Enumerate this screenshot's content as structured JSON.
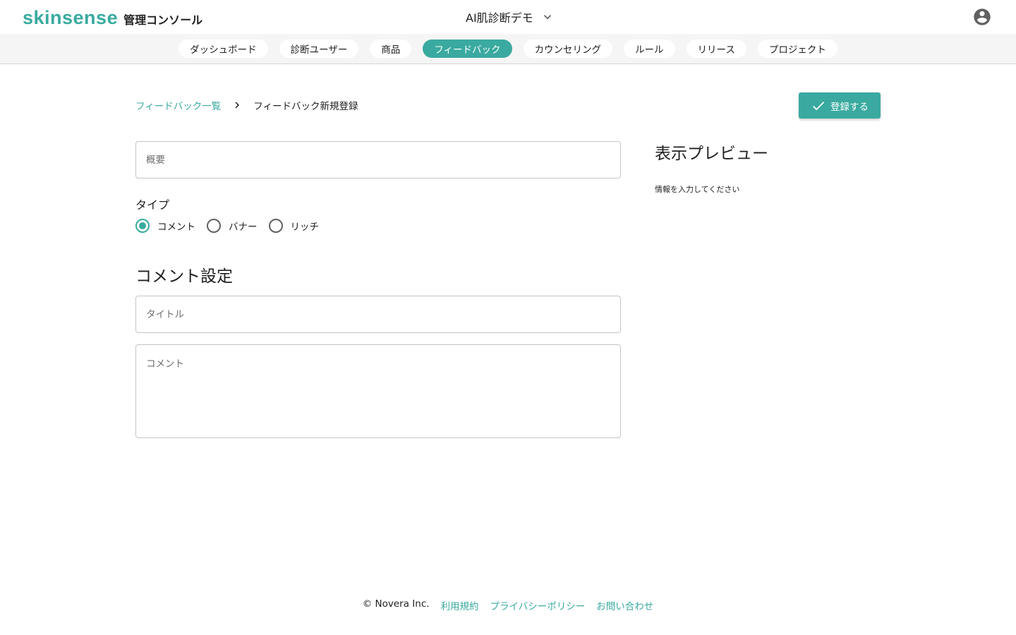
{
  "header": {
    "brand_logo": "skinsense",
    "brand_sub": "管理コンソール",
    "project_name": "AI肌診断デモ",
    "chevron_icon": "chevron-down-icon",
    "avatar_icon": "account-circle-icon"
  },
  "nav": {
    "tabs": [
      {
        "label": "ダッシュボード",
        "active": false
      },
      {
        "label": "診断ユーザー",
        "active": false
      },
      {
        "label": "商品",
        "active": false
      },
      {
        "label": "フィードバック",
        "active": true
      },
      {
        "label": "カウンセリング",
        "active": false
      },
      {
        "label": "ルール",
        "active": false
      },
      {
        "label": "リリース",
        "active": false
      },
      {
        "label": "プロジェクト",
        "active": false
      }
    ]
  },
  "breadcrumb": {
    "parent": "フィードバック一覧",
    "current": "フィードバック新規登録"
  },
  "actions": {
    "submit_label": "登録する",
    "submit_icon": "check-icon"
  },
  "form": {
    "summary_placeholder": "概要",
    "summary_value": "",
    "type_label": "タイプ",
    "type_options": [
      {
        "label": "コメント",
        "checked": true
      },
      {
        "label": "バナー",
        "checked": false
      },
      {
        "label": "リッチ",
        "checked": false
      }
    ],
    "section_title": "コメント設定",
    "title_placeholder": "タイトル",
    "title_value": "",
    "comment_placeholder": "コメント",
    "comment_value": ""
  },
  "preview": {
    "title": "表示プレビュー",
    "empty_message": "情報を入力してください"
  },
  "footer": {
    "copyright": "© Novera Inc.",
    "links": [
      "利用規約",
      "プライバシーポリシー",
      "お問い合わせ"
    ]
  },
  "colors": {
    "accent": "#3aaaa0",
    "nav_background": "#f5f5f5",
    "text": "#212121"
  }
}
